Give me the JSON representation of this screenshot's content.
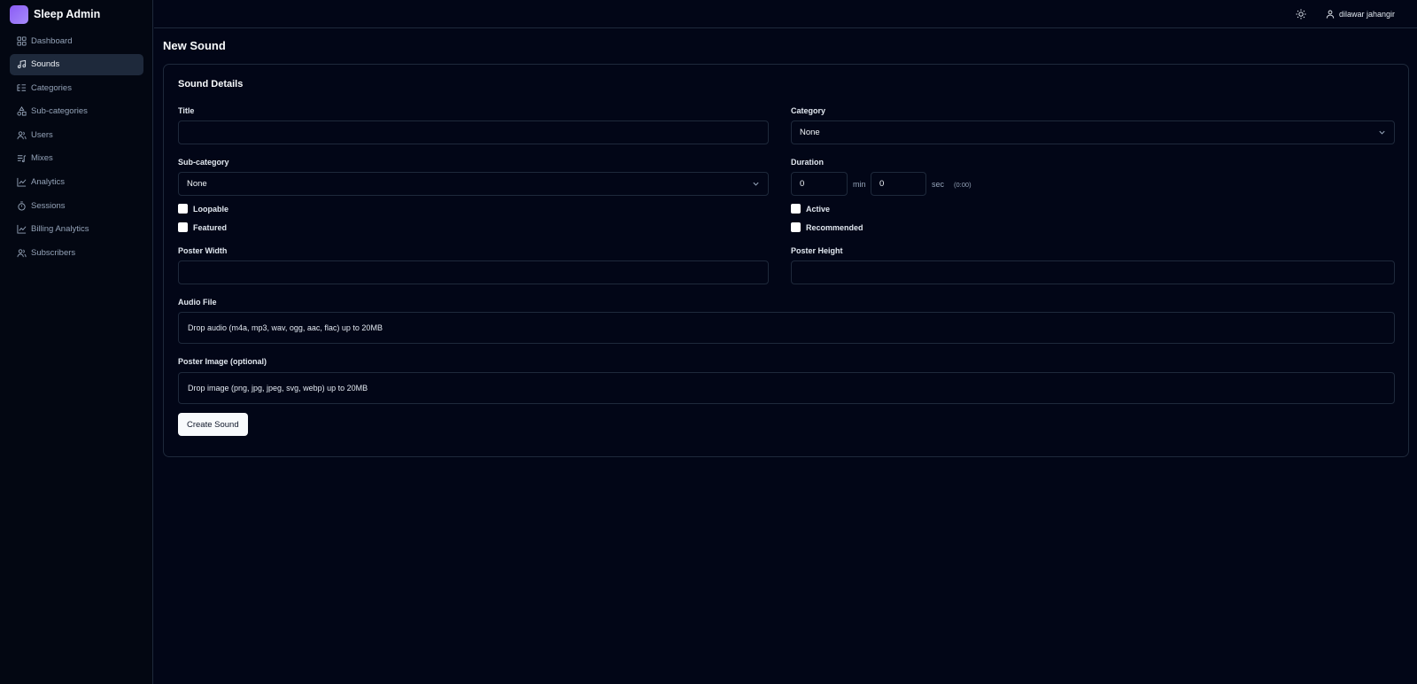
{
  "app": {
    "name": "Sleep Admin"
  },
  "sidebar": {
    "items": [
      {
        "label": "Dashboard",
        "icon": "grid-icon",
        "active": false
      },
      {
        "label": "Sounds",
        "icon": "music-note-icon",
        "active": true
      },
      {
        "label": "Categories",
        "icon": "list-tree-icon",
        "active": false
      },
      {
        "label": "Sub-categories",
        "icon": "shapes-icon",
        "active": false
      },
      {
        "label": "Users",
        "icon": "users-icon",
        "active": false
      },
      {
        "label": "Mixes",
        "icon": "list-music-icon",
        "active": false
      },
      {
        "label": "Analytics",
        "icon": "chart-line-icon",
        "active": false
      },
      {
        "label": "Sessions",
        "icon": "timer-icon",
        "active": false
      },
      {
        "label": "Billing Analytics",
        "icon": "chart-line-icon",
        "active": false
      },
      {
        "label": "Subscribers",
        "icon": "users-icon",
        "active": false
      }
    ]
  },
  "header": {
    "user_name": "dilawar jahangir"
  },
  "page": {
    "title": "New Sound"
  },
  "form": {
    "section_title": "Sound Details",
    "title_label": "Title",
    "title_value": "",
    "category_label": "Category",
    "category_value": "None",
    "subcategory_label": "Sub-category",
    "subcategory_value": "None",
    "duration_label": "Duration",
    "duration_min": "0",
    "duration_min_unit": "min",
    "duration_sec": "0",
    "duration_sec_unit": "sec",
    "duration_display": "(0:00)",
    "loopable_label": "Loopable",
    "featured_label": "Featured",
    "active_label": "Active",
    "recommended_label": "Recommended",
    "poster_width_label": "Poster Width",
    "poster_width_value": "",
    "poster_height_label": "Poster Height",
    "poster_height_value": "",
    "audio_label": "Audio File",
    "audio_drop": "Drop audio (m4a, mp3, wav, ogg, aac, flac) up to 20MB",
    "poster_label": "Poster Image (optional)",
    "poster_drop": "Drop image (png, jpg, jpeg, svg, webp) up to 20MB",
    "submit_label": "Create Sound"
  }
}
